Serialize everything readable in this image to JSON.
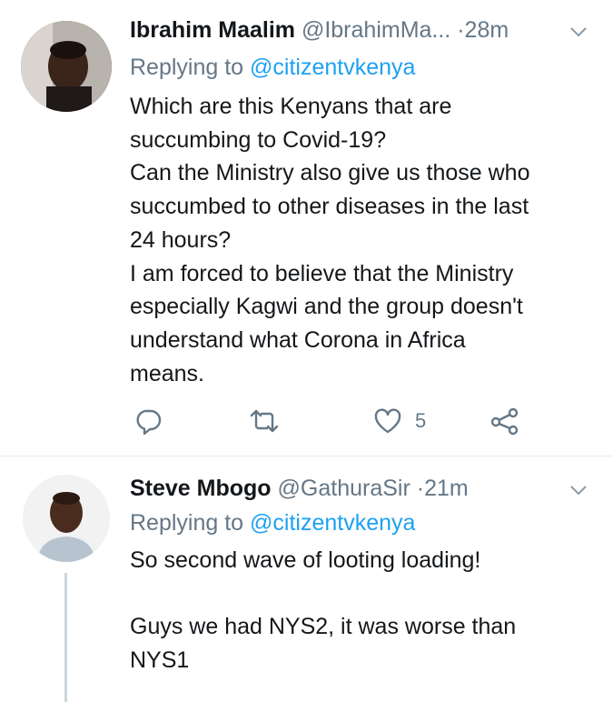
{
  "tweets": [
    {
      "name": "Ibrahim Maalim",
      "handle": "@IbrahimMa...",
      "separator": "·",
      "time": "28m",
      "replying_prefix": "Replying to",
      "replying_to": "@citizentvkenya",
      "lines": [
        "Which are this Kenyans that are",
        "succumbing to Covid-19?",
        "Can the Ministry also give us those who",
        "succumbed to other diseases in the last",
        "24 hours?",
        "I am forced to believe that the Ministry",
        "especially Kagwi and the group doesn't",
        "understand what Corona in Africa",
        "means."
      ],
      "actions": {
        "reply_icon": "reply-icon",
        "retweet_icon": "retweet-icon",
        "like_icon": "like-icon",
        "like_count": "5",
        "share_icon": "share-icon"
      }
    },
    {
      "name": "Steve Mbogo",
      "handle": "@GathuraSir",
      "separator": "·",
      "time": "21m",
      "replying_prefix": "Replying to",
      "replying_to": "@citizentvkenya",
      "lines": [
        "So second wave of looting loading!",
        "",
        "Guys we had NYS2, it was worse than",
        "NYS1"
      ]
    }
  ],
  "colors": {
    "link": "#1da1f2",
    "secondary": "#657786",
    "divider": "#e6ecf0"
  }
}
